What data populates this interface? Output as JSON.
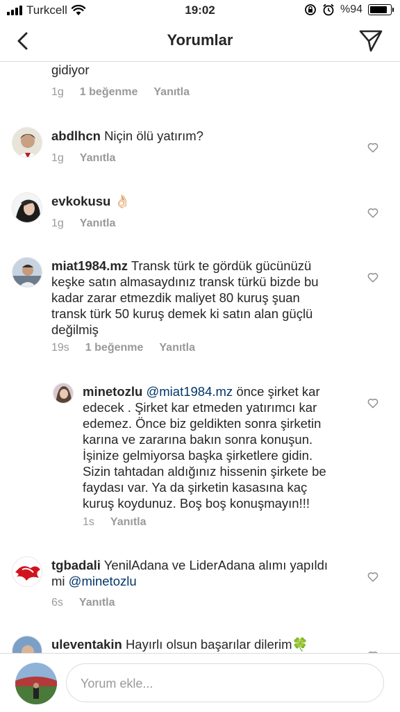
{
  "status_bar": {
    "carrier": "Turkcell",
    "time": "19:02",
    "battery": "%94",
    "battery_level": 0.94
  },
  "header": {
    "title": "Yorumlar"
  },
  "comments": [
    {
      "text": "gidiyor",
      "time": "1g",
      "likes": "1 beğenme",
      "reply": "Yanıtla"
    },
    {
      "username": "abdlhcn",
      "text": "Niçin ölü yatırım?",
      "time": "1g",
      "reply": "Yanıtla"
    },
    {
      "username": "evkokusu",
      "text": "👌🏻",
      "time": "1g",
      "reply": "Yanıtla"
    },
    {
      "username": "miat1984.mz",
      "text_line1": "Transk türk te gördük gücünüzü",
      "text_lines": [
        "keşke satın almasaydınız transk türkü bizde bu",
        "kadar zarar etmezdik maliyet 80 kuruş şuan",
        "transk türk 50 kuruş demek ki satın alan güçlü",
        "değilmiş"
      ],
      "time": "19s",
      "likes": "1 beğenme",
      "reply": "Yanıtla"
    },
    {
      "username": "minetozlu",
      "mention": "@miat1984.mz",
      "text_line1": "önce şirket kar",
      "text_lines": [
        "edecek . Şirket kar etmeden yatırımcı kar",
        "edemez. Önce biz geldikten sonra şirketin",
        "karına ve zararına bakın sonra konuşun.",
        "İşinize gelmiyorsa başka şirketlere gidin.",
        "Sizin tahtadan aldığınız hissenin şirkete be",
        "faydası var. Ya da şirketin kasasına kaç",
        "kuruş koydunuz. Boş boş konuşmayın!!!"
      ],
      "time": "1s",
      "reply": "Yanıtla"
    },
    {
      "username": "tgbadali",
      "text_line1": "YenilAdana ve LiderAdana alımı yapıldı",
      "text_line2_prefix": "mi",
      "mention": "@minetozlu",
      "time": "6s",
      "reply": "Yanıtla"
    },
    {
      "username": "uleventakin",
      "text": "Hayırlı olsun başarılar dilerim🍀"
    }
  ],
  "footer": {
    "placeholder": "Yorum ekle..."
  }
}
